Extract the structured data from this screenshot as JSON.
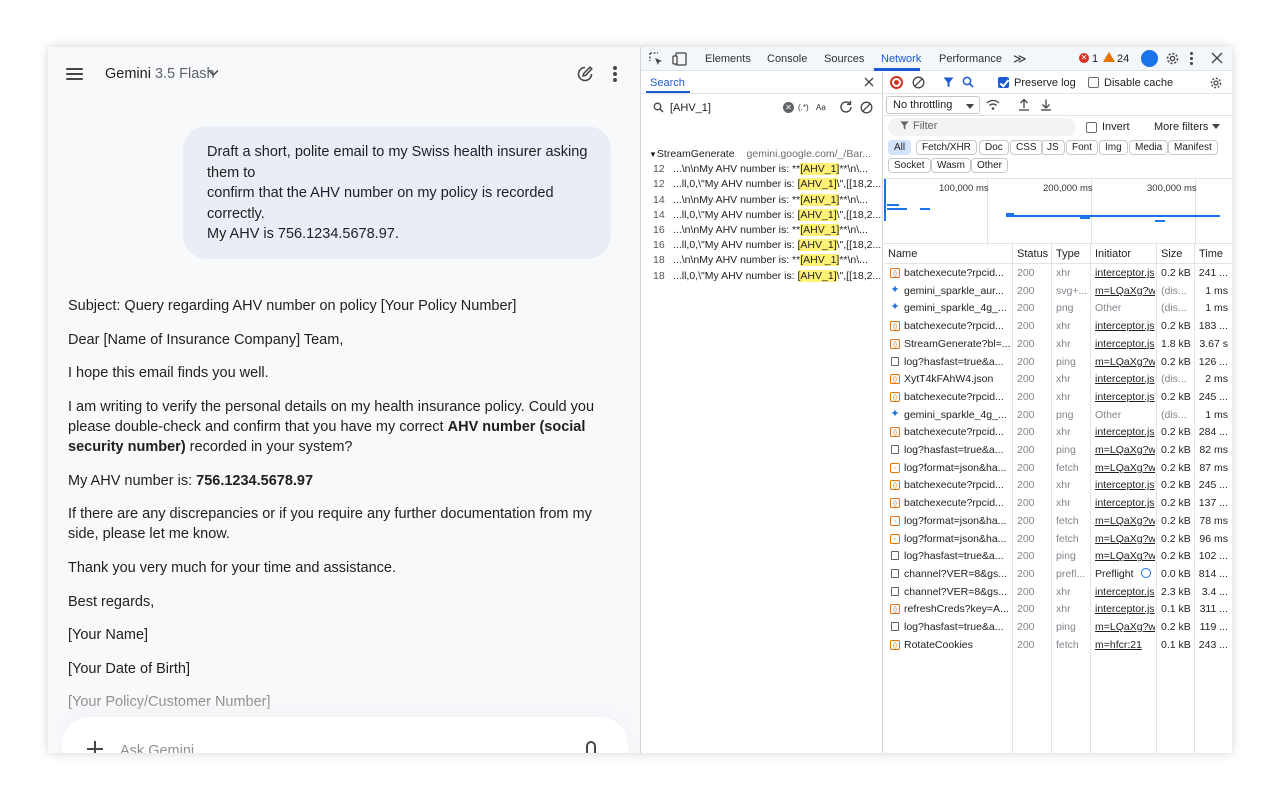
{
  "gemini": {
    "app_name": "Gemini",
    "model": "3.5 Flash",
    "prompt_lines": [
      "Draft a short, polite email to my Swiss health insurer asking",
      "them to",
      "confirm that the AHV number on my policy is recorded",
      "correctly.",
      "My AHV is 756.1234.5678.97."
    ],
    "response": {
      "subject": "Subject: Query regarding AHV number on policy [Your Policy Number]",
      "greeting": "Dear [Name of Insurance Company] Team,",
      "opener": "I hope this email finds you well.",
      "body1_line1": "I am writing to verify the personal details on my health insurance policy. Could you",
      "body1_line2": "please double-check and confirm that you have my correct ",
      "body1_bold1": "AHV number (social",
      "body1_bold2": "security number)",
      "body1_line3": " recorded in your system?",
      "ahv_label": "My AHV number is: ",
      "ahv_value": "756.1234.5678.97",
      "body2_line1": "If there are any discrepancies or if you require any further documentation from my",
      "body2_line2": "side, please let me know.",
      "thanks": "Thank you very much for your time and assistance.",
      "closing": "Best regards,",
      "name": "[Your Name]",
      "dob": "[Your Date of Birth]",
      "policy": "[Your Policy/Customer Number]"
    },
    "input_placeholder": "Ask Gemini"
  },
  "devtools": {
    "tabs": [
      "Elements",
      "Console",
      "Sources",
      "Network",
      "Performance"
    ],
    "more_tabs": "≫",
    "error_count": "1",
    "warning_count": "24",
    "search": {
      "title": "Search",
      "query": "[AHV_1]",
      "regex_label": "(.*)",
      "case_label": "Aa",
      "file_name": "StreamGenerate",
      "file_url": "gemini.google.com/_/Bar...",
      "results": [
        {
          "line": "12",
          "pre": "...\\n\\nMy AHV number is: **",
          "match": "[AHV_1]",
          "post": "**\\n\\..."
        },
        {
          "line": "12",
          "pre": "...ll,0,\\\"My AHV number is: ",
          "match": "[AHV_1]",
          "post": "\\\",[[18,2..."
        },
        {
          "line": "14",
          "pre": "...\\n\\nMy AHV number is: **",
          "match": "[AHV_1]",
          "post": "**\\n\\..."
        },
        {
          "line": "14",
          "pre": "...ll,0,\\\"My AHV number is: ",
          "match": "[AHV_1]",
          "post": "\\\",[[18,2..."
        },
        {
          "line": "16",
          "pre": "...\\n\\nMy AHV number is: **",
          "match": "[AHV_1]",
          "post": "**\\n\\..."
        },
        {
          "line": "16",
          "pre": "...ll,0,\\\"My AHV number is: ",
          "match": "[AHV_1]",
          "post": "\\\",[[18,2..."
        },
        {
          "line": "18",
          "pre": "...\\n\\nMy AHV number is: **",
          "match": "[AHV_1]",
          "post": "**\\n\\..."
        },
        {
          "line": "18",
          "pre": "...ll,0,\\\"My AHV number is: ",
          "match": "[AHV_1]",
          "post": "\\\",[[18,2..."
        }
      ]
    },
    "network": {
      "preserve_log": "Preserve log",
      "disable_cache": "Disable cache",
      "throttling": "No throttling",
      "filter_placeholder": "Filter",
      "invert": "Invert",
      "more_filters": "More filters",
      "types": [
        "All",
        "Fetch/XHR",
        "Doc",
        "CSS",
        "JS",
        "Font",
        "Img",
        "Media",
        "Manifest",
        "Socket",
        "Wasm",
        "Other"
      ],
      "overview_ticks": [
        "100,000 ms",
        "200,000 ms",
        "300,000 ms"
      ],
      "columns": [
        "Name",
        "Status",
        "Type",
        "Initiator",
        "Size",
        "Time"
      ],
      "rows": [
        {
          "icon": "xhr",
          "name": "batchexecute?rpcid...",
          "status": "200",
          "type": "xhr",
          "initiator": "interceptor.js",
          "size": "0.2 kB",
          "time": "241 ..."
        },
        {
          "icon": "svg",
          "name": "gemini_sparkle_aur...",
          "status": "200",
          "type": "svg+...",
          "initiator": "m=LQaXg?w",
          "size": "(dis...",
          "time": "1 ms"
        },
        {
          "icon": "png",
          "name": "gemini_sparkle_4g_...",
          "status": "200",
          "type": "png",
          "initiator": "Other",
          "size": "(dis...",
          "time": "1 ms"
        },
        {
          "icon": "xhr",
          "name": "batchexecute?rpcid...",
          "status": "200",
          "type": "xhr",
          "initiator": "interceptor.js",
          "size": "0.2 kB",
          "time": "183 ..."
        },
        {
          "icon": "xhr",
          "name": "StreamGenerate?bl=...",
          "status": "200",
          "type": "xhr",
          "initiator": "interceptor.js",
          "size": "1.8 kB",
          "time": "3.67 s"
        },
        {
          "icon": "ping",
          "name": "log?hasfast=true&a...",
          "status": "200",
          "type": "ping",
          "initiator": "m=LQaXg?w",
          "size": "0.2 kB",
          "time": "126 ..."
        },
        {
          "icon": "xhr",
          "name": "XytT4kFAhW4.json",
          "status": "200",
          "type": "xhr",
          "initiator": "interceptor.js",
          "size": "(dis...",
          "time": "2 ms"
        },
        {
          "icon": "xhr",
          "name": "batchexecute?rpcid...",
          "status": "200",
          "type": "xhr",
          "initiator": "interceptor.js",
          "size": "0.2 kB",
          "time": "245 ..."
        },
        {
          "icon": "png",
          "name": "gemini_sparkle_4g_...",
          "status": "200",
          "type": "png",
          "initiator": "Other",
          "size": "(dis...",
          "time": "1 ms"
        },
        {
          "icon": "xhr",
          "name": "batchexecute?rpcid...",
          "status": "200",
          "type": "xhr",
          "initiator": "interceptor.js",
          "size": "0.2 kB",
          "time": "284 ..."
        },
        {
          "icon": "ping",
          "name": "log?hasfast=true&a...",
          "status": "200",
          "type": "ping",
          "initiator": "m=LQaXg?w",
          "size": "0.2 kB",
          "time": "82 ms"
        },
        {
          "icon": "fetch",
          "name": "log?format=json&ha...",
          "status": "200",
          "type": "fetch",
          "initiator": "m=LQaXg?w",
          "size": "0.2 kB",
          "time": "87 ms"
        },
        {
          "icon": "xhr",
          "name": "batchexecute?rpcid...",
          "status": "200",
          "type": "xhr",
          "initiator": "interceptor.js",
          "size": "0.2 kB",
          "time": "245 ..."
        },
        {
          "icon": "xhr",
          "name": "batchexecute?rpcid...",
          "status": "200",
          "type": "xhr",
          "initiator": "interceptor.js",
          "size": "0.2 kB",
          "time": "137 ..."
        },
        {
          "icon": "fetch",
          "name": "log?format=json&ha...",
          "status": "200",
          "type": "fetch",
          "initiator": "m=LQaXg?w",
          "size": "0.2 kB",
          "time": "78 ms"
        },
        {
          "icon": "fetch",
          "name": "log?format=json&ha...",
          "status": "200",
          "type": "fetch",
          "initiator": "m=LQaXg?w",
          "size": "0.2 kB",
          "time": "96 ms"
        },
        {
          "icon": "ping",
          "name": "log?hasfast=true&a...",
          "status": "200",
          "type": "ping",
          "initiator": "m=LQaXg?w",
          "size": "0.2 kB",
          "time": "102 ..."
        },
        {
          "icon": "ping",
          "name": "channel?VER=8&gs...",
          "status": "200",
          "type": "prefl...",
          "initiator": "Preflight",
          "size": "0.0 kB",
          "time": "814 ..."
        },
        {
          "icon": "doc",
          "name": "channel?VER=8&gs...",
          "status": "200",
          "type": "xhr",
          "initiator": "interceptor.js",
          "size": "2.3 kB",
          "time": "3.4 ..."
        },
        {
          "icon": "xhr",
          "name": "refreshCreds?key=A...",
          "status": "200",
          "type": "xhr",
          "initiator": "interceptor.js",
          "size": "0.1 kB",
          "time": "311 ..."
        },
        {
          "icon": "ping",
          "name": "log?hasfast=true&a...",
          "status": "200",
          "type": "ping",
          "initiator": "m=LQaXg?w",
          "size": "0.2 kB",
          "time": "119 ..."
        },
        {
          "icon": "xhr",
          "name": "RotateCookies",
          "status": "200",
          "type": "fetch",
          "initiator": "m=hfcr:21",
          "size": "0.1 kB",
          "time": "243 ..."
        }
      ]
    }
  }
}
